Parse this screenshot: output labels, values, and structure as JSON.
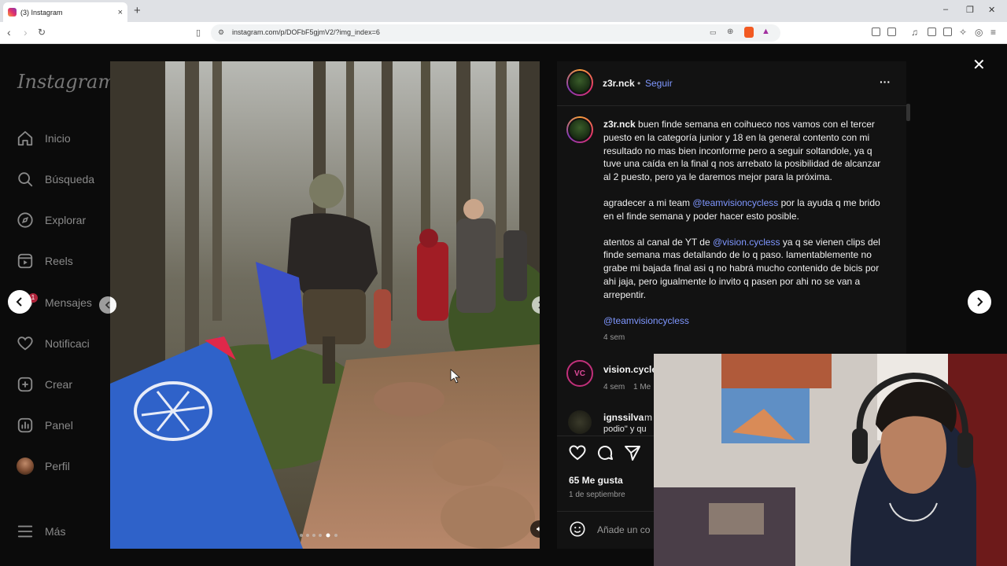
{
  "browser": {
    "tab_title": "(3) Instagram",
    "tab_close": "×",
    "new_tab": "+",
    "url": "instagram.com/p/DOFbF5gjmV2/?img_index=6",
    "window_controls": [
      "–",
      "❐",
      "✕"
    ]
  },
  "sidebar": {
    "logo": "Instagram",
    "items": [
      {
        "label": "Inicio",
        "icon": "home-icon"
      },
      {
        "label": "Búsqueda",
        "icon": "search-icon"
      },
      {
        "label": "Explorar",
        "icon": "compass-icon"
      },
      {
        "label": "Reels",
        "icon": "reels-icon"
      },
      {
        "label": "Mensajes",
        "icon": "messenger-icon",
        "badge": "1"
      },
      {
        "label": "Notificaci",
        "icon": "heart-icon"
      },
      {
        "label": "Crear",
        "icon": "plus-square-icon"
      },
      {
        "label": "Panel",
        "icon": "chart-icon"
      },
      {
        "label": "Perfil",
        "icon": "profile-avatar"
      },
      {
        "label": "Más",
        "icon": "menu-icon"
      }
    ]
  },
  "post": {
    "username": "z3r.nck",
    "separator": "•",
    "follow_label": "Seguir",
    "more_label": "···",
    "caption_p1": "buen finde semana en coihueco nos vamos con el tercer puesto en la categoría junior y 18 en la general contento con mi resultado no mas bien inconforme pero a seguir soltandole, ya q tuve una caída en la final q nos arrebato la posibilidad de alcanzar al 2 puesto, pero ya le daremos mejor para la próxima.",
    "caption_p2_a": "agradecer a mi team ",
    "caption_p2_mention": "@teamvisioncycless",
    "caption_p2_b": " por la ayuda q me brido en el finde semana y poder hacer esto posible.",
    "caption_p3_a": "atentos al canal de YT de ",
    "caption_p3_mention": "@vision.cycless",
    "caption_p3_b": " ya q se vienen clips del finde semana mas detallando de lo q paso. lamentablemente no grabe mi bajada final asi q no habrá mucho contenido de bicis por ahi jaja, pero igualmente lo invito q pasen por ahi no se van a arrepentir.",
    "caption_tag": "@teamvisioncycless",
    "caption_time": "4 sem",
    "comments": [
      {
        "user": "vision.cycle",
        "time": "4 sem",
        "likes": "1 Me"
      },
      {
        "user": "ignssilva",
        "text_a": "m",
        "text_b": "podio\" y qu"
      }
    ],
    "likes": "65 Me gusta",
    "date": "1 de septiembre",
    "add_comment_placeholder": "Añade un co",
    "close": "✕"
  },
  "colors": {
    "accent_link": "#7f97ff",
    "background": "#0b0b0b",
    "panel": "#121212",
    "notification_badge": "#b0243b"
  }
}
